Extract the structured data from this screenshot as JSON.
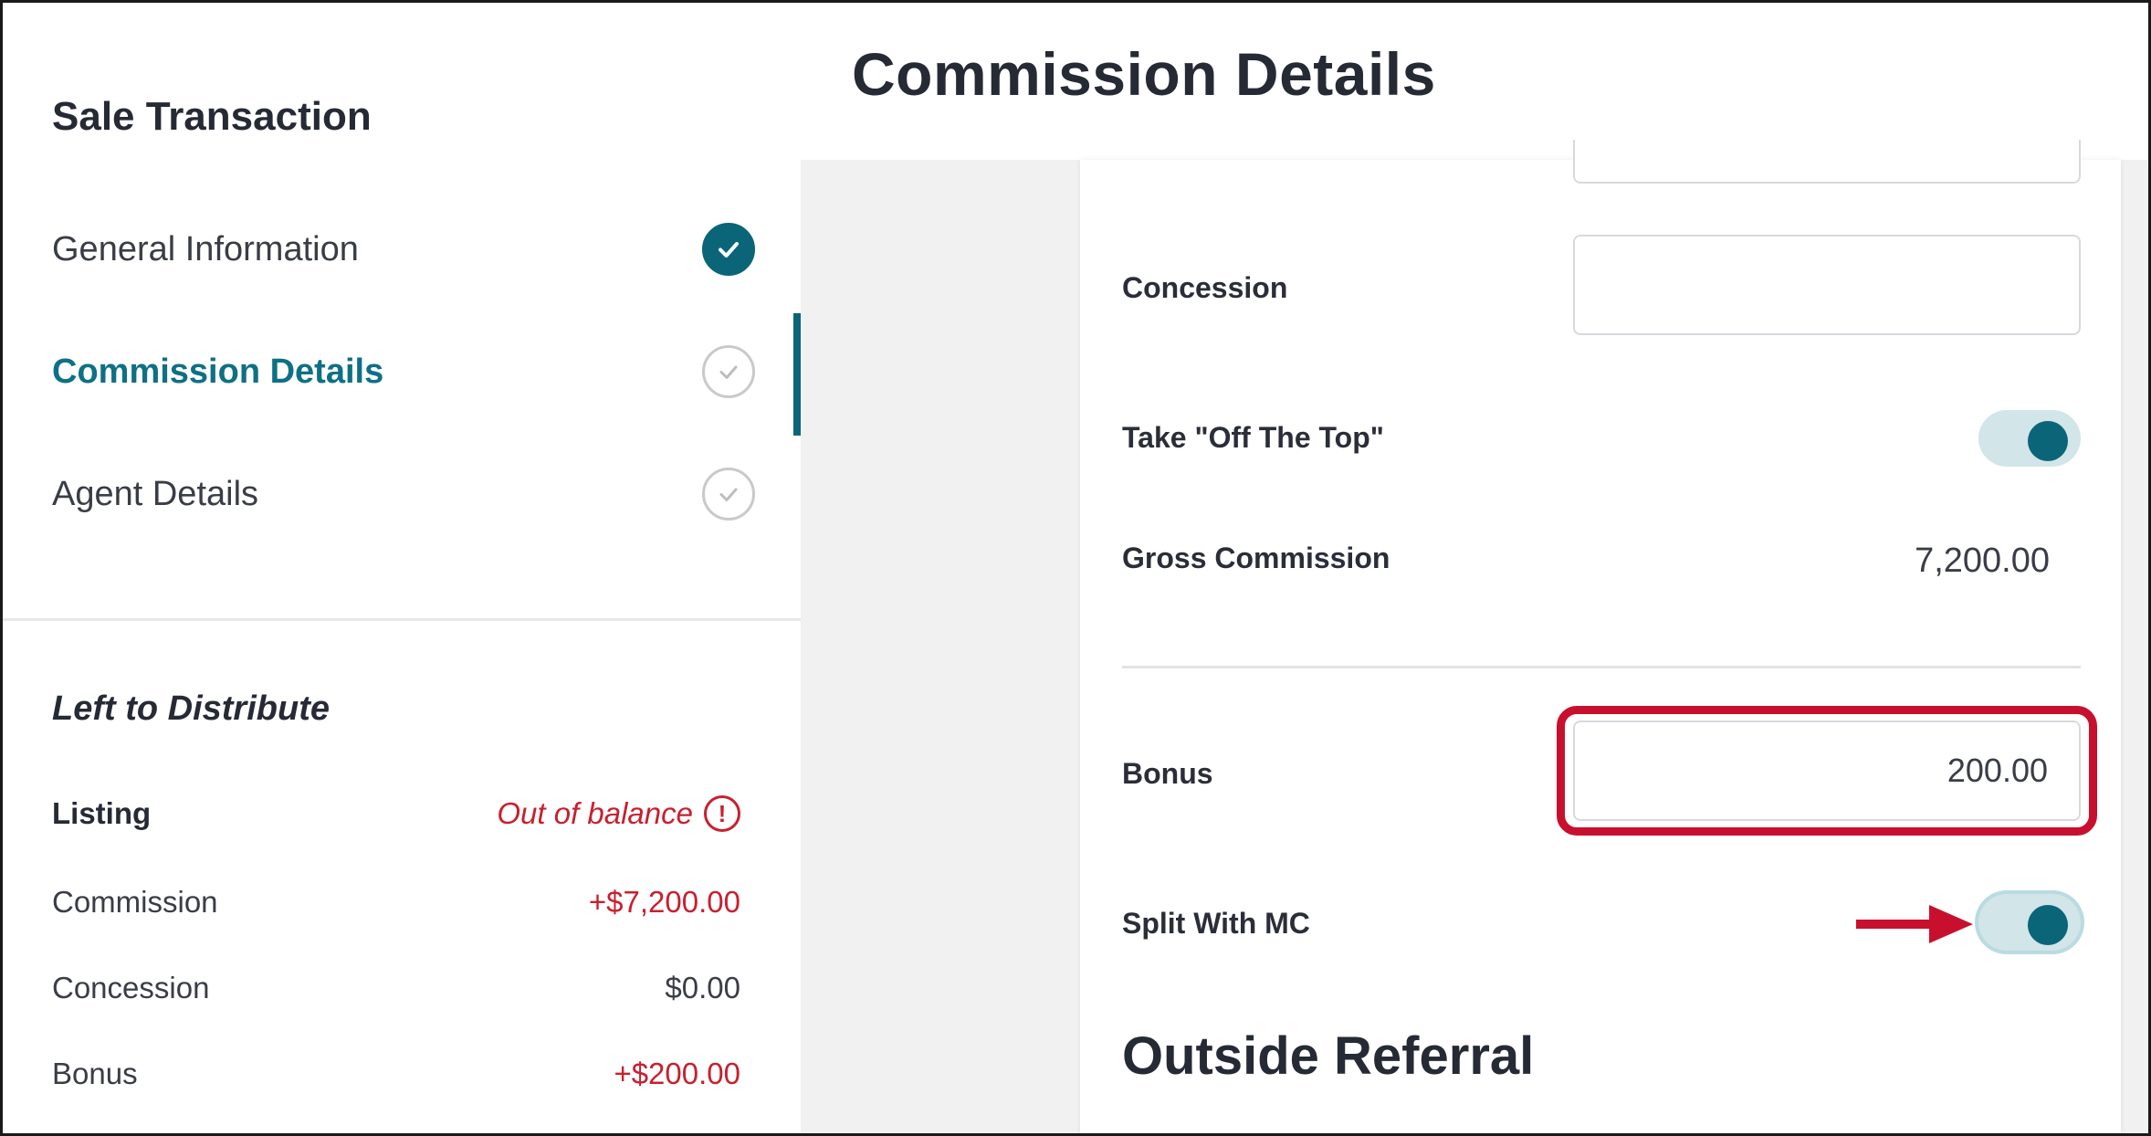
{
  "header": {
    "page_title": "Commission Details",
    "section_title": "Sale Transaction"
  },
  "sidebar": {
    "steps": [
      {
        "label": "General Information",
        "status": "complete"
      },
      {
        "label": "Commission Details",
        "status": "active"
      },
      {
        "label": "Agent Details",
        "status": "pending"
      }
    ],
    "left_to_distribute": {
      "title": "Left to Distribute",
      "listing_label": "Listing",
      "listing_status": "Out of balance",
      "rows": [
        {
          "label": "Commission",
          "value": "+$7,200.00"
        },
        {
          "label": "Concession",
          "value": "$0.00"
        },
        {
          "label": "Bonus",
          "value": "+$200.00"
        }
      ]
    }
  },
  "form": {
    "concession_label": "Concession",
    "concession_value": "",
    "off_the_top_label": "Take \"Off The Top\"",
    "off_the_top_on": true,
    "gross_commission_label": "Gross Commission",
    "gross_commission_value": "7,200.00",
    "bonus_label": "Bonus",
    "bonus_value": "200.00",
    "split_with_mc_label": "Split With MC",
    "split_with_mc_on": true,
    "outside_referral_heading": "Outside Referral"
  },
  "colors": {
    "accent": "#0b6578",
    "alert": "#c8202f",
    "highlight": "#c8102e"
  }
}
